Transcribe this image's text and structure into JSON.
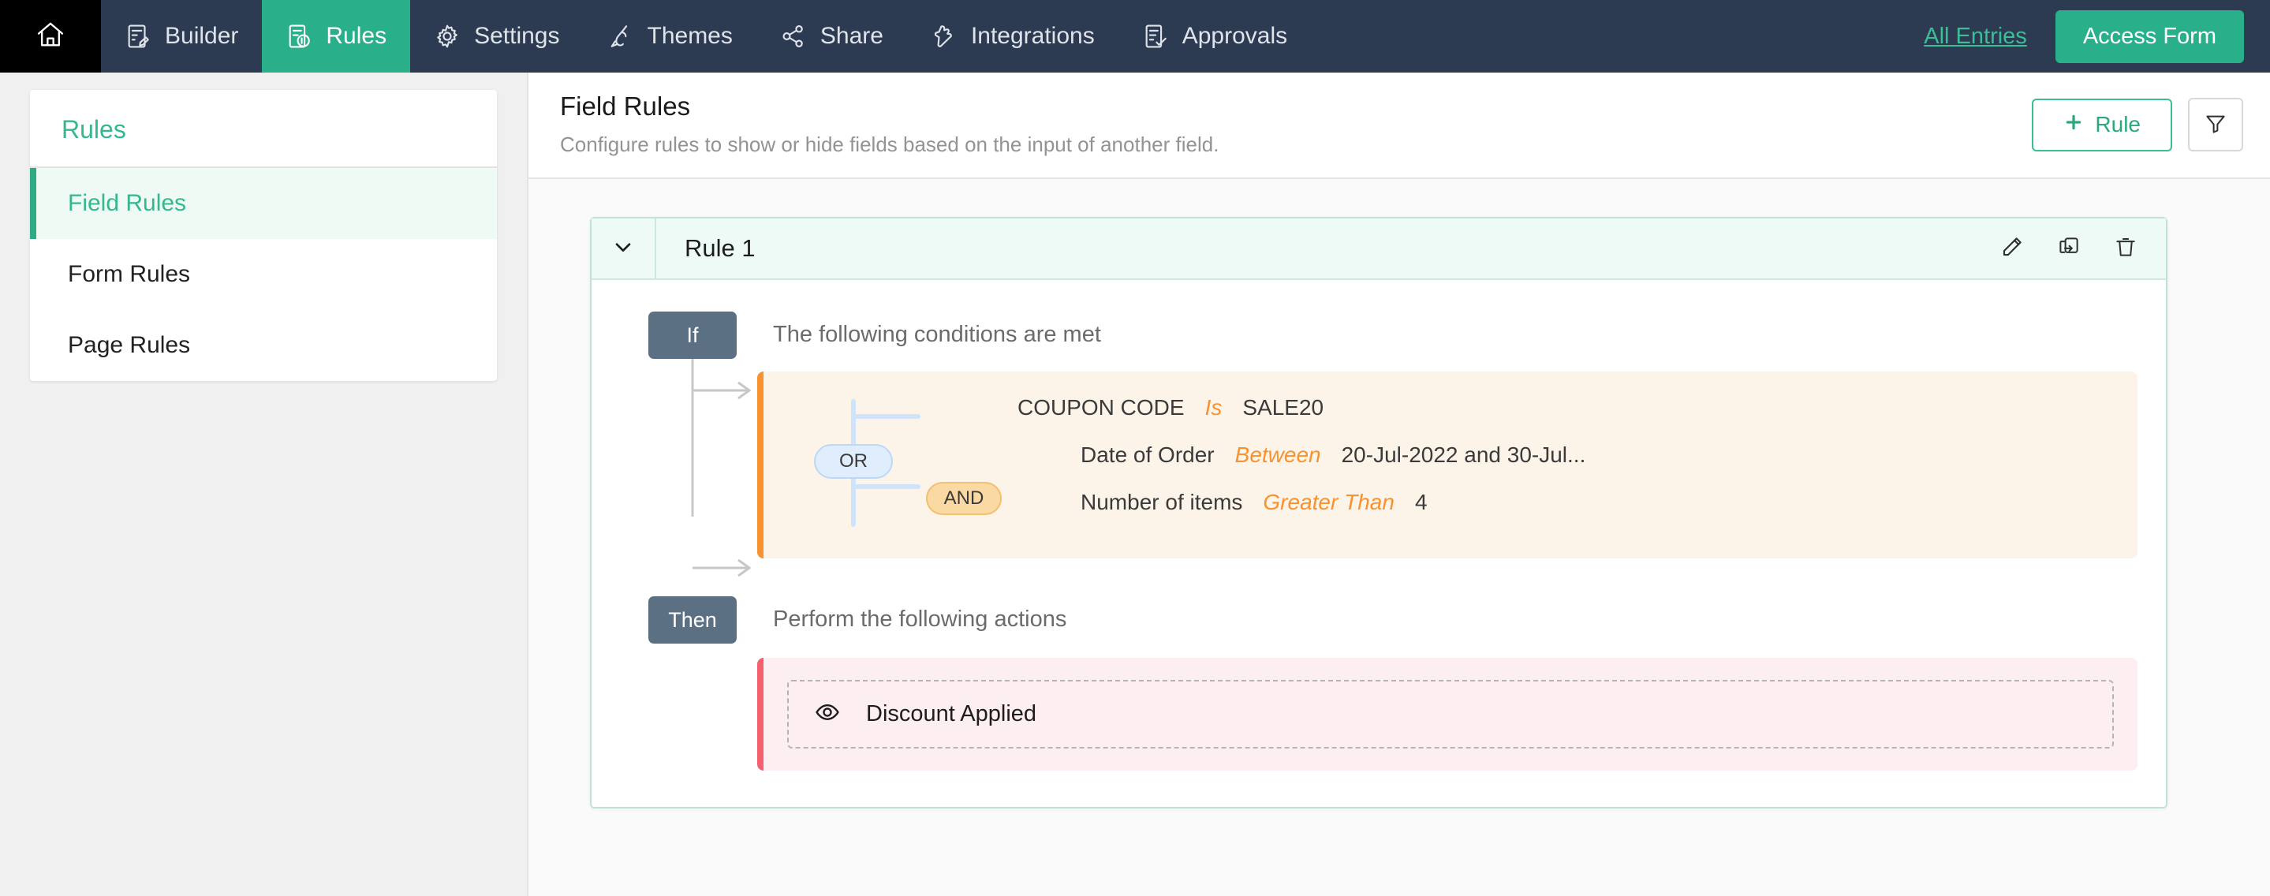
{
  "topnav": {
    "home_icon": "home-icon",
    "items": [
      {
        "label": "Builder",
        "icon": "form-builder-icon",
        "active": false
      },
      {
        "label": "Rules",
        "icon": "rules-icon",
        "active": true
      },
      {
        "label": "Settings",
        "icon": "gear-icon",
        "active": false
      },
      {
        "label": "Themes",
        "icon": "brush-icon",
        "active": false
      },
      {
        "label": "Share",
        "icon": "share-icon",
        "active": false
      },
      {
        "label": "Integrations",
        "icon": "puzzle-icon",
        "active": false
      },
      {
        "label": "Approvals",
        "icon": "approval-checklist-icon",
        "active": false
      }
    ],
    "all_entries_label": "All Entries",
    "access_form_label": "Access Form",
    "bg_color": "#2d3b52",
    "accent_color": "#29b08a"
  },
  "sidebar": {
    "title": "Rules",
    "items": [
      {
        "label": "Field Rules",
        "active": true
      },
      {
        "label": "Form Rules",
        "active": false
      },
      {
        "label": "Page Rules",
        "active": false
      }
    ]
  },
  "main": {
    "title": "Field Rules",
    "subtitle": "Configure rules to show or hide fields based on the input of another field.",
    "add_rule_label": "Rule",
    "add_rule_icon": "plus-icon",
    "filter_icon": "funnel-icon"
  },
  "rule": {
    "name": "Rule 1",
    "collapse_icon": "chevron-down-icon",
    "edit_icon": "pencil-icon",
    "duplicate_icon": "duplicate-icon",
    "delete_icon": "trash-icon",
    "if_badge": "If",
    "if_text": "The following conditions are met",
    "then_badge": "Then",
    "then_text": "Perform the following actions",
    "logic": {
      "or": "OR",
      "and": "AND"
    },
    "conditions": [
      {
        "field": "COUPON CODE",
        "operator": "Is",
        "value": "SALE20"
      },
      {
        "field": "Date of Order",
        "operator": "Between",
        "value": "20-Jul-2022 and 30-Jul..."
      },
      {
        "field": "Number of items",
        "operator": "Greater Than",
        "value": "4"
      }
    ],
    "actions": [
      {
        "icon": "eye-icon",
        "label": "Discount Applied"
      }
    ],
    "colors": {
      "condition_accent": "#f7922f",
      "condition_bg": "#fdf4e9",
      "action_accent": "#f4606e",
      "action_bg": "#fdeff1",
      "badge_bg": "#5c7084",
      "card_border": "#bfe4d7"
    }
  }
}
